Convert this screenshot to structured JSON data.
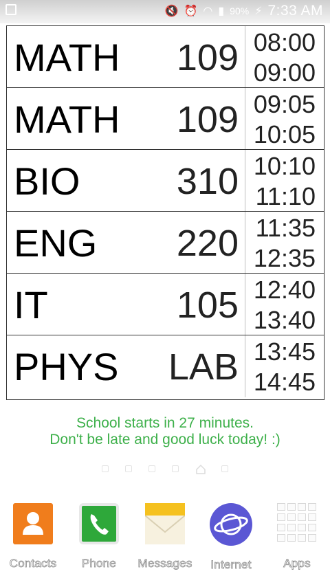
{
  "status_bar": {
    "battery": "90%",
    "time": "7:33 AM"
  },
  "schedule": [
    {
      "subject": "MATH",
      "room": "109",
      "start": "08:00",
      "end": "09:00"
    },
    {
      "subject": "MATH",
      "room": "109",
      "start": "09:05",
      "end": "10:05"
    },
    {
      "subject": "BIO",
      "room": "310",
      "start": "10:10",
      "end": "11:10"
    },
    {
      "subject": "ENG",
      "room": "220",
      "start": "11:35",
      "end": "12:35"
    },
    {
      "subject": "IT",
      "room": "105",
      "start": "12:40",
      "end": "13:40"
    },
    {
      "subject": "PHYS",
      "room": "LAB",
      "start": "13:45",
      "end": "14:45"
    }
  ],
  "message": {
    "line1": "School starts in 27 minutes.",
    "line2": "Don't be late and good luck today! :)"
  },
  "colors": {
    "message": "#3db04a",
    "contacts": "#f07d1c",
    "phone": "#2ea83a",
    "messages": "#f5c11f",
    "internet": "#5b57d4"
  },
  "dock": [
    {
      "label": "Contacts",
      "icon": "contacts-icon"
    },
    {
      "label": "Phone",
      "icon": "phone-icon"
    },
    {
      "label": "Messages",
      "icon": "messages-icon"
    },
    {
      "label": "Internet",
      "icon": "internet-icon"
    },
    {
      "label": "Apps",
      "icon": "apps-grid-icon"
    }
  ]
}
